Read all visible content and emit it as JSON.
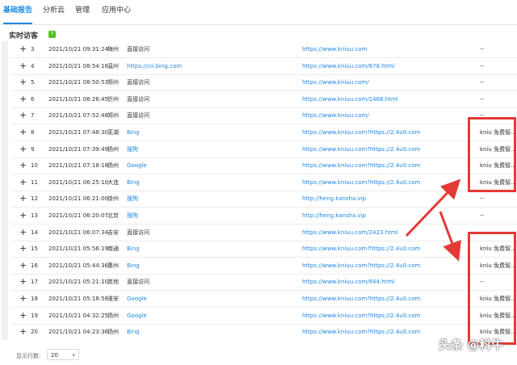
{
  "tabs": [
    "基础报告",
    "分析云",
    "管理",
    "应用中心"
  ],
  "panel": {
    "title": "实时访客",
    "help_icon": "?"
  },
  "rows": [
    {
      "idx": "3",
      "time": "2021/10/21 09:31:24",
      "city": "梅州",
      "src": "直接访问",
      "src_link": false,
      "url": "https://www.kniuu.com",
      "kw": "--"
    },
    {
      "idx": "4",
      "time": "2021/10/21 08:54:16",
      "city": "温州",
      "src": "https://cn.bing.com",
      "src_link": true,
      "url": "https://www.kniuu.com/678.html",
      "kw": "--"
    },
    {
      "idx": "5",
      "time": "2021/10/21 08:50:53",
      "city": "郑州",
      "src": "直接访问",
      "src_link": false,
      "url": "https://www.kniuu.com/",
      "kw": "--"
    },
    {
      "idx": "6",
      "time": "2021/10/21 08:26:45",
      "city": "忻州",
      "src": "直接访问",
      "src_link": false,
      "url": "https://www.kniuu.com/1468.html",
      "kw": "--"
    },
    {
      "idx": "7",
      "time": "2021/10/21 07:52:48",
      "city": "郑州",
      "src": "直接访问",
      "src_link": false,
      "url": "https://www.kniuu.com/",
      "kw": "--"
    },
    {
      "idx": "8",
      "time": "2021/10/21 07:48:30",
      "city": "芜湖",
      "src": "Bing",
      "src_link": true,
      "url": "https://www.kniuu.com?https://2.4u0.com",
      "kw": "kniu 免费智..."
    },
    {
      "idx": "9",
      "time": "2021/10/21 07:39:49",
      "city": "扬州",
      "src": "搜狗",
      "src_link": true,
      "url": "https://www.kniuu.com?https://2.4u0.com",
      "kw": "kniu 免费智..."
    },
    {
      "idx": "10",
      "time": "2021/10/21 07:18:18",
      "city": "扬州",
      "src": "Google",
      "src_link": true,
      "url": "https://www.kniuu.com?https://2.4u0.com",
      "kw": "kniu 免费智..."
    },
    {
      "idx": "11",
      "time": "2021/10/21 06:25:10",
      "city": "大连",
      "src": "Bing",
      "src_link": true,
      "url": "https://www.kniuu.com?https://2.4u0.com",
      "kw": "kniu 免费智..."
    },
    {
      "idx": "12",
      "time": "2021/10/21 06:21:00",
      "city": "徐州",
      "src": "搜狗",
      "src_link": true,
      "url": "http://heng.kansha.vip",
      "kw": "--"
    },
    {
      "idx": "13",
      "time": "2021/10/21 06:20:07",
      "city": "北京",
      "src": "搜狗",
      "src_link": true,
      "url": "http://heng.kansha.vip",
      "kw": "--"
    },
    {
      "idx": "14",
      "time": "2021/10/21 06:07:34",
      "city": "吉安",
      "src": "直接访问",
      "src_link": false,
      "url": "https://www.kniuu.com/2423.html",
      "kw": "--"
    },
    {
      "idx": "15",
      "time": "2021/10/21 05:56:19",
      "city": "南通",
      "src": "Bing",
      "src_link": true,
      "url": "https://www.kniuu.com?https://2.4u0.com",
      "kw": "kniu 免费智..."
    },
    {
      "idx": "16",
      "time": "2021/10/21 05:44:36",
      "city": "惠州",
      "src": "Bing",
      "src_link": true,
      "url": "https://www.kniuu.com?https://2.4u0.com",
      "kw": "kniu 免费智..."
    },
    {
      "idx": "17",
      "time": "2021/10/21 05:21:10",
      "city": "其他",
      "src": "直接访问",
      "src_link": false,
      "url": "https://www.kniuu.com/844.html",
      "kw": "--"
    },
    {
      "idx": "18",
      "time": "2021/10/21 05:18:58",
      "city": "淮安",
      "src": "Google",
      "src_link": true,
      "url": "https://www.kniuu.com?https://2.4u0.com",
      "kw": "kniu 免费智..."
    },
    {
      "idx": "19",
      "time": "2021/10/21 04:32:25",
      "city": "扬州",
      "src": "Google",
      "src_link": true,
      "url": "https://www.kniuu.com?https://2.4u0.com",
      "kw": "kniu 免费智..."
    },
    {
      "idx": "20",
      "time": "2021/10/21 04:23:36",
      "city": "扬州",
      "src": "Bing",
      "src_link": true,
      "url": "https://www.kniuu.com?https://2.4u0.com",
      "kw": "kniu 免费智..."
    }
  ],
  "footer": {
    "label": "显示行数:",
    "rows_value": "20"
  },
  "watermark": "头条 @科牛",
  "colors": {
    "link": "#1e88e5",
    "highlight": "#e53935",
    "active_tab": "#1e88e5"
  }
}
